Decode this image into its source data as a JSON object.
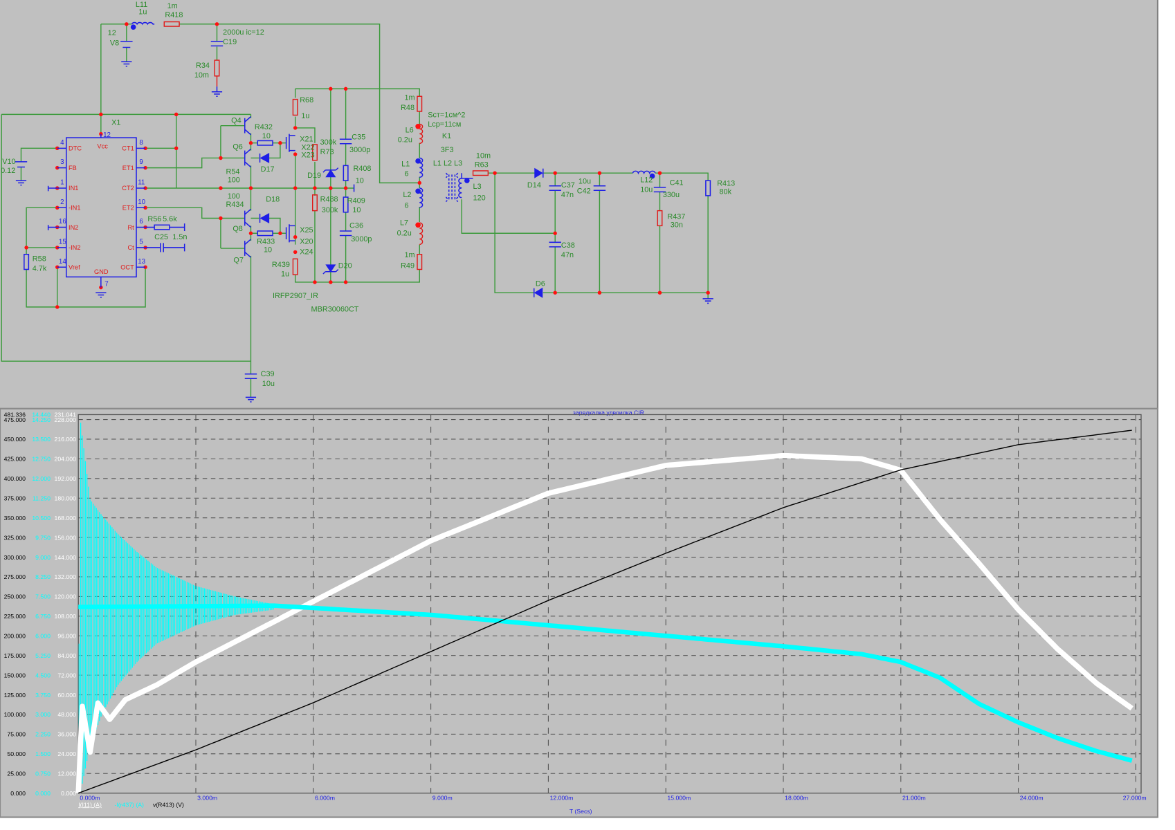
{
  "sch": {
    "L11": "L11",
    "L11v": "1u",
    "R418v": "1m",
    "R418": "R418",
    "V8v": "12",
    "V8": "V8",
    "C19v": "2000u ic=12",
    "C19": "C19",
    "R34": "R34",
    "R34v": "10m",
    "X1": "X1",
    "V10": "V10",
    "V10v": "0.12",
    "R58": "R58",
    "R58v": "4.7k",
    "R56": "R56",
    "R56v": "5.6k",
    "C25": "C25",
    "C25v": "1.5n",
    "Q4": "Q4",
    "Q6": "Q6",
    "Q8": "Q8",
    "Q7": "Q7",
    "R432": "R432",
    "R432v": "10",
    "R54": "R54",
    "R54v": "100",
    "R434v": "100",
    "R434": "R434",
    "D17": "D17",
    "D18": "D18",
    "R433": "R433",
    "R433v": "10",
    "R68": "R68",
    "R68v": "1u",
    "X21": "X21",
    "X22": "X22",
    "X23": "X23",
    "X25": "X25",
    "X20": "X20",
    "X24": "X24",
    "R439": "R439",
    "R439v": "1u",
    "R73v": "300k",
    "R73": "R73",
    "R488": "R488",
    "R488v": "300k",
    "D19": "D19",
    "D20": "D20",
    "C35": "C35",
    "C35v": "3000p",
    "R408": "R408",
    "R408v": "10",
    "R409": "R409",
    "R409v": "10",
    "C36": "C36",
    "C36v": "3000p",
    "IRFP": "IRFP2907_IR",
    "MBR": "MBR30060CT",
    "R48v": "1m",
    "R48": "R48",
    "L6": "L6",
    "L6v": "0.2u",
    "L1": "L1",
    "L1v": "6",
    "L2": "L2",
    "L2v": "6",
    "L7": "L7",
    "L7v": "0.2u",
    "R49v": "1m",
    "R49": "R49",
    "K1a": "Sст=1см^2",
    "K1b": "Lср=11см",
    "K1": "K1",
    "K1m": "3F3",
    "K1l": "L1  L2  L3",
    "R63v": "10m",
    "R63": "R63",
    "L3": "L3",
    "L3v": "120",
    "D14": "D14",
    "C37": "C37",
    "C37v": "47n",
    "C42v": "10u",
    "C42": "C42",
    "L12": "L12",
    "L12v": "10u",
    "C41": "C41",
    "C41v": "330u",
    "R437": "R437",
    "R437v": "30n",
    "R413": "R413",
    "R413v": "80k",
    "C38": "C38",
    "C38v": "47n",
    "D6": "D6",
    "C39": "C39",
    "C39v": "10u"
  },
  "x1": {
    "vcc": {
      "name": "Vcc",
      "num": "12"
    },
    "gnd": {
      "name": "GND",
      "num": "7"
    },
    "left": [
      {
        "name": "DTC",
        "num": "4"
      },
      {
        "name": "FB",
        "num": "3"
      },
      {
        "name": "IN1",
        "num": "1"
      },
      {
        "name": "-IN1",
        "num": "2"
      },
      {
        "name": "IN2",
        "num": "16"
      },
      {
        "name": "-IN2",
        "num": "15"
      },
      {
        "name": "Vref",
        "num": "14"
      }
    ],
    "right": [
      {
        "name": "CT1",
        "num": "8"
      },
      {
        "name": "ET1",
        "num": "9"
      },
      {
        "name": "CT2",
        "num": "11"
      },
      {
        "name": "ET2",
        "num": "10"
      },
      {
        "name": "Rt",
        "num": "6"
      },
      {
        "name": "Ct",
        "num": "5"
      },
      {
        "name": "OCT",
        "num": "13"
      }
    ]
  },
  "colors": {
    "background": "#c0c0c0",
    "wire": "#3a9a3a",
    "component_blue": "#1e1ee6",
    "component_red": "#e01818",
    "plot_black": "#000000",
    "plot_cyan": "#00ffff",
    "plot_white": "#ffffff",
    "axis_blue": "#1e1ee6"
  },
  "chart_data": {
    "type": "line",
    "title": "зарядкалка удвоилка.CIR",
    "xlabel": "T (Secs)",
    "x_ticks": [
      "0.000m",
      "3.000m",
      "6.000m",
      "9.000m",
      "12.000m",
      "15.000m",
      "18.000m",
      "21.000m",
      "24.000m",
      "27.000m"
    ],
    "xlim_ms": [
      0,
      27
    ],
    "grid": true,
    "axes": [
      {
        "name": "v(R413) (V)",
        "color": "#000000",
        "max_label": "481.336",
        "ylim": [
          0,
          481.336
        ],
        "ticks": [
          "0.000",
          "25.000",
          "50.000",
          "75.000",
          "100.000",
          "125.000",
          "150.000",
          "175.000",
          "200.000",
          "225.000",
          "250.000",
          "275.000",
          "300.000",
          "325.000",
          "350.000",
          "375.000",
          "400.000",
          "425.000",
          "450.000",
          "475.000"
        ]
      },
      {
        "name": "-I(r437) (A)",
        "color": "#00ffff",
        "max_label": "14.440",
        "ylim": [
          0,
          14.44
        ],
        "ticks": [
          "0.000",
          "0.750",
          "1.500",
          "2.250",
          "3.000",
          "3.750",
          "4.500",
          "5.250",
          "6.000",
          "6.750",
          "7.500",
          "8.250",
          "9.000",
          "9.750",
          "10.500",
          "11.250",
          "12.000",
          "12.750",
          "13.500",
          "14.250"
        ]
      },
      {
        "name": "I(I11) (A)",
        "color": "#ffffff",
        "max_label": "231.041",
        "ylim": [
          0,
          231.041
        ],
        "ticks": [
          "0.000",
          "12.000",
          "24.000",
          "36.000",
          "48.000",
          "60.000",
          "72.000",
          "84.000",
          "96.000",
          "108.000",
          "120.000",
          "132.000",
          "144.000",
          "156.000",
          "168.000",
          "180.000",
          "192.000",
          "204.000",
          "216.000",
          "228.000"
        ]
      }
    ],
    "legend": [
      "I(I11) (A)",
      "-I(r437) (A)",
      "v(R413) (V)"
    ],
    "series": [
      {
        "name": "I(I11) (A)",
        "axis": 2,
        "color": "#ffffff",
        "t_ms": [
          0,
          0.05,
          0.3,
          0.5,
          0.8,
          1.2,
          2,
          3,
          6,
          9,
          12,
          15,
          18,
          20,
          21,
          22,
          23,
          24,
          25,
          26,
          27
        ],
        "values": [
          0,
          60,
          25,
          55,
          45,
          57,
          66,
          80,
          117,
          154,
          183,
          200,
          206,
          204,
          197,
          167,
          140,
          112,
          88,
          67,
          50
        ]
      },
      {
        "name": "-I(r437) (A)",
        "axis": 1,
        "color": "#00ffff",
        "t_ms": [
          0,
          5,
          9,
          12,
          15,
          18,
          20,
          21,
          22,
          23,
          24,
          25,
          26,
          27
        ],
        "values": [
          7.1,
          7.15,
          6.8,
          6.4,
          6.0,
          5.6,
          5.3,
          5.0,
          4.4,
          3.4,
          2.7,
          2.1,
          1.6,
          1.2
        ],
        "oscillation": {
          "t_ms": [
            0,
            0.05,
            0.3,
            0.6,
            1,
            1.5,
            2,
            3,
            4,
            5
          ],
          "upper": [
            0,
            14.25,
            11.2,
            10.6,
            9.9,
            9.2,
            8.6,
            7.9,
            7.5,
            7.2
          ],
          "lower": [
            0,
            0,
            1.8,
            3.0,
            4.1,
            5.0,
            5.7,
            6.4,
            6.8,
            7.0
          ]
        }
      },
      {
        "name": "v(R413) (V)",
        "axis": 0,
        "color": "#000000",
        "t_ms": [
          0,
          3,
          6,
          9,
          12,
          15,
          18,
          21,
          24,
          27
        ],
        "values": [
          0,
          55,
          115,
          180,
          245,
          305,
          363,
          411,
          443,
          462
        ]
      }
    ]
  }
}
